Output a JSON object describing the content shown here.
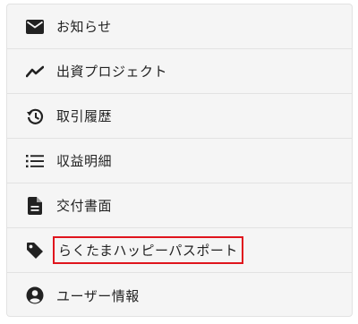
{
  "menu": {
    "items": [
      {
        "label": "お知らせ",
        "icon": "mail-icon"
      },
      {
        "label": "出資プロジェクト",
        "icon": "trending-icon"
      },
      {
        "label": "取引履歴",
        "icon": "history-icon"
      },
      {
        "label": "収益明細",
        "icon": "list-icon"
      },
      {
        "label": "交付書面",
        "icon": "document-icon"
      },
      {
        "label": "らくたまハッピーパスポート",
        "icon": "tag-icon",
        "highlighted": true
      },
      {
        "label": "ユーザー情報",
        "icon": "account-icon"
      }
    ]
  },
  "colors": {
    "highlight_border": "#e0151d",
    "icon": "#222222",
    "background": "#f5f5f5"
  }
}
